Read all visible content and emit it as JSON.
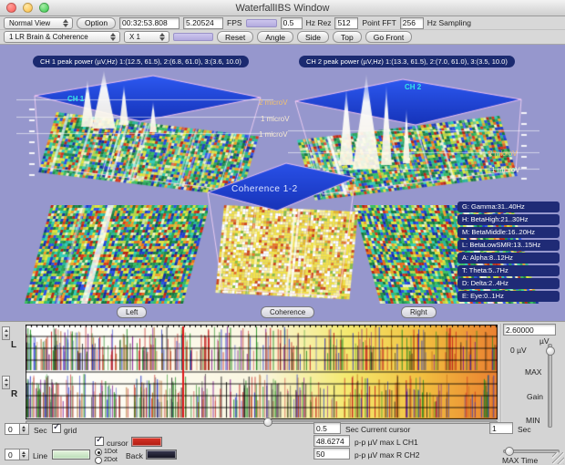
{
  "window": {
    "title": "WaterfallIBS Window"
  },
  "toolbar1": {
    "view_dropdown": "Normal View",
    "option_button": "Option",
    "time": "00:32:53.808",
    "fps_value": "5.20524",
    "fps_label": "FPS",
    "hz_rez_value": "0.5",
    "hz_rez_label": "Hz Rez",
    "fft_value": "512",
    "fft_label": "Point FFT",
    "sampling_value": "256",
    "sampling_label": "Hz Sampling"
  },
  "toolbar2": {
    "mode_dropdown": "1 LR Brain & Coherence",
    "zoom_dropdown": "X 1",
    "reset_button": "Reset",
    "angle_button": "Angle",
    "side_button": "Side",
    "top_button": "Top",
    "go_front_button": "Go Front"
  },
  "scene": {
    "ch1_peak_text": "CH 1 peak power (µV,Hz) 1:(12.5, 61.5), 2:(6.8, 61.0), 3:(3.6, 10.0)",
    "ch2_peak_text": "CH 2 peak power (µV,Hz) 1:(13.3, 61.5), 2:(7.0, 61.0), 3:(3.5, 10.0)",
    "ch1_label": "CH 1",
    "ch2_label": "CH 2",
    "coherence_title": "Coherence 1-2",
    "left_scale": [
      "2 microV",
      "1 microV",
      "1 microV"
    ],
    "right_scale": [
      "2 microV",
      "1 microV"
    ],
    "floor": {
      "left": "Left",
      "center": "Coherence",
      "right": "Right"
    },
    "legend": [
      "G: Gamma:31..40Hz",
      "H: BetaHigh:21..30Hz",
      "M: BetaMiddle:16..20Hz",
      "L: BetaLowSMR:13..15Hz",
      "A: Alpha:8..12Hz",
      "T: Theta:5..7Hz",
      "D: Delta:2..4Hz",
      "E: Eye:0..1Hz"
    ]
  },
  "bottom": {
    "l_label": "L",
    "r_label": "R",
    "gain_value": "2.60000",
    "uv_label": "µV",
    "zero_uv_label": "0 µV",
    "max_label": "MAX",
    "gain_label": "Gain",
    "min_label": "MIN",
    "left_stepper_value": "0",
    "sec_label": "Sec",
    "grid_label": "grid",
    "cursor_label": "cursor",
    "current_cursor_value": "0.5",
    "current_cursor_label": "Sec Current cursor",
    "window_sec_value": "1",
    "window_sec_label": "Sec",
    "line_label": "Line",
    "dot1_label": "1Dot",
    "dot2_label": "2Dot",
    "back_label": "Back",
    "pp_l_value": "48.6274",
    "pp_l_label": "p-p µV max L CH1",
    "pp_r_value": "50",
    "pp_r_label": "p-p µV max R CH2",
    "max_time_label": "MAX Time",
    "bottom_stepper_value": "0"
  },
  "colors": {
    "scene_bg": "#9697cd",
    "legend_pill": "#1f2b76",
    "peak_pill": "#1b2a70",
    "cursor_swatch": "#c22018",
    "line_swatch": "#cfe8cc",
    "back_swatch": "#14141f",
    "meter_fill": "#beb6e6"
  }
}
